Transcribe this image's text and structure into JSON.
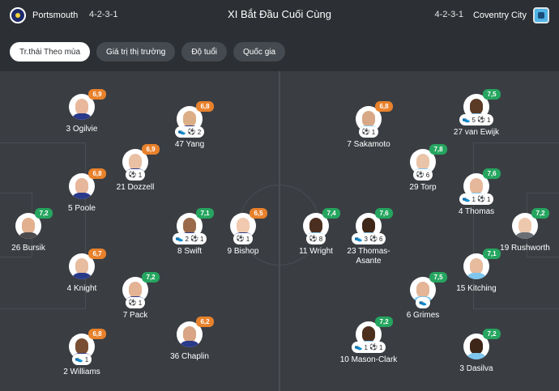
{
  "header": {
    "home_team": "Portsmouth",
    "home_formation": "4-2-3-1",
    "title": "XI Bắt Đầu Cuối Cùng",
    "away_formation": "4-2-3-1",
    "away_team": "Coventry City"
  },
  "tabs": [
    {
      "label": "Tr.thái Theo mùa",
      "active": true
    },
    {
      "label": "Giá trị thị trường",
      "active": false
    },
    {
      "label": "Độ tuổi",
      "active": false
    },
    {
      "label": "Quốc gia",
      "active": false
    }
  ],
  "colors": {
    "rating_high": "#25a55f",
    "rating_mid": "#e8812b",
    "pitch": "#3a3e43",
    "background": "#2c2f33"
  },
  "players": {
    "home": [
      {
        "name": "3 Ogilvie",
        "rating": "6,9",
        "events": ""
      },
      {
        "name": "47 Yang",
        "rating": "6,8",
        "events": "2"
      },
      {
        "name": "21 Dozzell",
        "rating": "6,9",
        "events": "1"
      },
      {
        "name": "5 Poole",
        "rating": "6,8",
        "events": ""
      },
      {
        "name": "26 Bursik",
        "rating": "7,2",
        "events": ""
      },
      {
        "name": "8 Swift",
        "rating": "7,1",
        "events_a": "2",
        "events_b": "1"
      },
      {
        "name": "9 Bishop",
        "rating": "6,5",
        "events": "1"
      },
      {
        "name": "4 Knight",
        "rating": "6,7",
        "events": ""
      },
      {
        "name": "7 Pack",
        "rating": "7,2",
        "events": "1"
      },
      {
        "name": "36 Chaplin",
        "rating": "6,2",
        "events": ""
      },
      {
        "name": "2 Williams",
        "rating": "6,8",
        "events": "1"
      }
    ],
    "away": [
      {
        "name": "7 Sakamoto",
        "rating": "6,8",
        "events": "1"
      },
      {
        "name": "27 van Ewijk",
        "rating": "7,5",
        "events_a": "5",
        "events_b": "1"
      },
      {
        "name": "29 Torp",
        "rating": "7,8",
        "events": "6"
      },
      {
        "name": "4 Thomas",
        "rating": "7,6",
        "events_a": "1",
        "events_b": "1"
      },
      {
        "name": "11 Wright",
        "rating": "7,4",
        "events": "8"
      },
      {
        "name": "23 Thomas-",
        "name2": "Asante",
        "rating": "7,6",
        "events_a": "3",
        "events_b": "6"
      },
      {
        "name": "19 Rushworth",
        "rating": "7,2",
        "events": ""
      },
      {
        "name": "15 Kitching",
        "rating": "7,1",
        "events": ""
      },
      {
        "name": "6 Grimes",
        "rating": "7,5",
        "events": ""
      },
      {
        "name": "10 Mason-Clark",
        "rating": "7,2",
        "events_a": "1",
        "events_b": "1"
      },
      {
        "name": "3 Dasilva",
        "rating": "7,2",
        "events": ""
      }
    ]
  }
}
